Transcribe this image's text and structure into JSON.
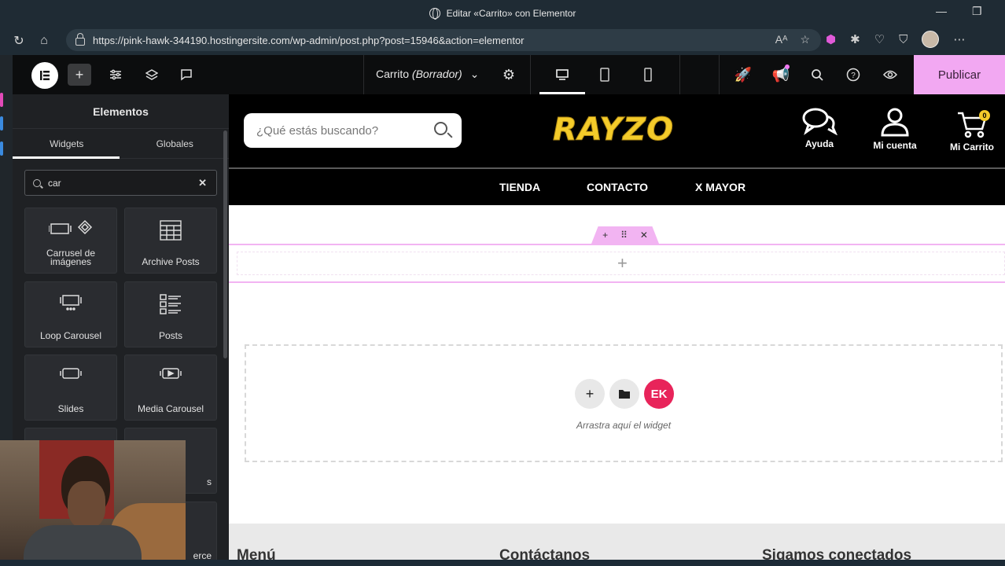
{
  "browser": {
    "window_title": "Editar «Carrito» con Elementor",
    "url": "https://pink-hawk-344190.hostingersite.com/wp-admin/post.php?post=15946&action=elementor"
  },
  "editor": {
    "document_title": "Carrito",
    "document_status": "(Borrador)",
    "publish_label": "Publicar"
  },
  "panel": {
    "title": "Elementos",
    "tabs": [
      "Widgets",
      "Globales"
    ],
    "search_value": "car",
    "widgets": [
      {
        "label": "Carrusel de imágenes",
        "icon": "image-carousel-icon"
      },
      {
        "label": "Archive Posts",
        "icon": "archive-posts-icon"
      },
      {
        "label": "Loop Carousel",
        "icon": "loop-carousel-icon"
      },
      {
        "label": "Posts",
        "icon": "posts-icon"
      },
      {
        "label": "Slides",
        "icon": "slides-icon"
      },
      {
        "label": "Media Carousel",
        "icon": "media-carousel-icon"
      },
      {
        "label": "s",
        "icon": "widget-icon"
      },
      {
        "label": "erce",
        "icon": "widget-icon"
      }
    ]
  },
  "site": {
    "search_placeholder": "¿Qué estás buscando?",
    "brand": "RAYZO",
    "header_links": [
      {
        "label": "Ayuda",
        "icon": "chat-bubbles-icon"
      },
      {
        "label": "Mi cuenta",
        "icon": "user-icon"
      },
      {
        "label": "Mi Carrito",
        "icon": "cart-icon",
        "badge": "0"
      }
    ],
    "nav": [
      "TIENDA",
      "CONTACTO",
      "X MAYOR"
    ],
    "drop_hint": "Arrastra aquí el widget",
    "footer_headings": [
      "Menú",
      "Contáctanos",
      "Sigamos conectados"
    ]
  },
  "colors": {
    "publish_bg": "#f2a8f2",
    "brand_yellow": "#f4cb2a",
    "elementor_kit": "#e8245a"
  }
}
